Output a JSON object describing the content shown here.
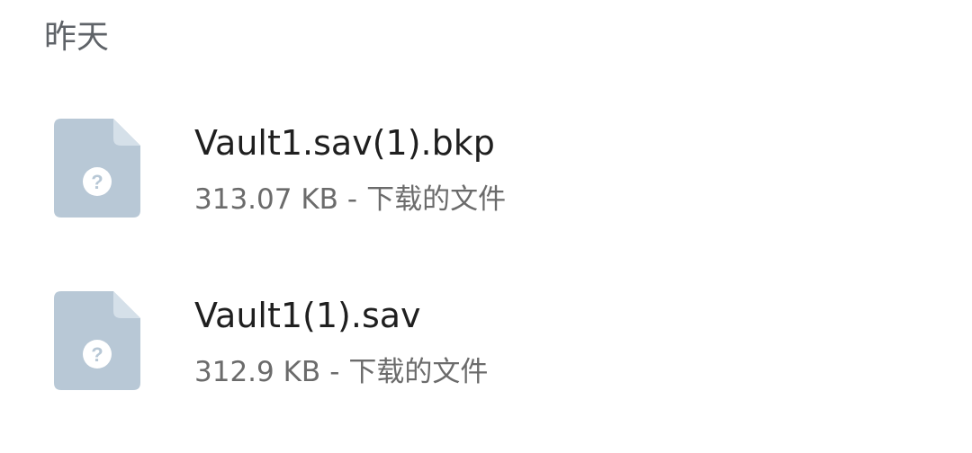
{
  "section": {
    "title": "昨天"
  },
  "files": [
    {
      "name": "Vault1.sav(1).bkp",
      "size": "313.07 KB",
      "separator": "-",
      "source": "下载的文件",
      "icon": "unknown-file-icon",
      "icon_color": "#b8c8d6"
    },
    {
      "name": "Vault1(1).sav",
      "size": "312.9 KB",
      "separator": "-",
      "source": "下载的文件",
      "icon": "unknown-file-icon",
      "icon_color": "#b8c8d6"
    }
  ]
}
